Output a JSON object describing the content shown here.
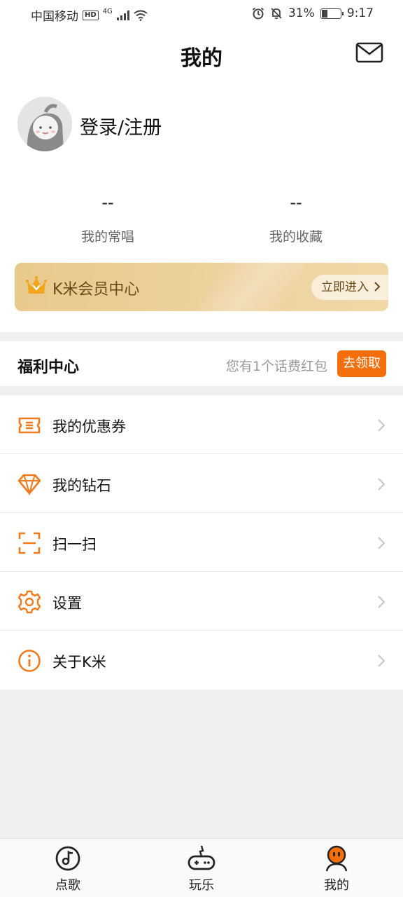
{
  "status_bar": {
    "carrier": "中国移动",
    "hd": "HD",
    "network": "4G",
    "battery_percent": "31%",
    "time": "9:17"
  },
  "header": {
    "title": "我的",
    "mail_icon": "mail-icon"
  },
  "profile": {
    "avatar_icon": "avatar-icon",
    "login_label": "登录/注册"
  },
  "stats": [
    {
      "value": "--",
      "label": "我的常唱"
    },
    {
      "value": "--",
      "label": "我的收藏"
    }
  ],
  "vip": {
    "title": "K米会员中心",
    "enter_label": "立即进入",
    "icon": "crown-icon",
    "colors": {
      "card": "#edd29f",
      "text": "#6b4a1a"
    }
  },
  "welfare": {
    "title": "福利中心",
    "tip": "您有1个话费红包",
    "claim_label": "去领取",
    "accent": "#f56e0c"
  },
  "menu": [
    {
      "label": "我的优惠券",
      "icon": "coupon-icon"
    },
    {
      "label": "我的钻石",
      "icon": "diamond-icon"
    },
    {
      "label": "扫一扫",
      "icon": "scan-icon"
    },
    {
      "label": "设置",
      "icon": "gear-icon"
    },
    {
      "label": "关于K米",
      "icon": "info-icon"
    }
  ],
  "bottom_nav": [
    {
      "label": "点歌",
      "icon": "music-note-icon"
    },
    {
      "label": "玩乐",
      "icon": "gamepad-icon"
    },
    {
      "label": "我的",
      "icon": "profile-icon"
    }
  ]
}
